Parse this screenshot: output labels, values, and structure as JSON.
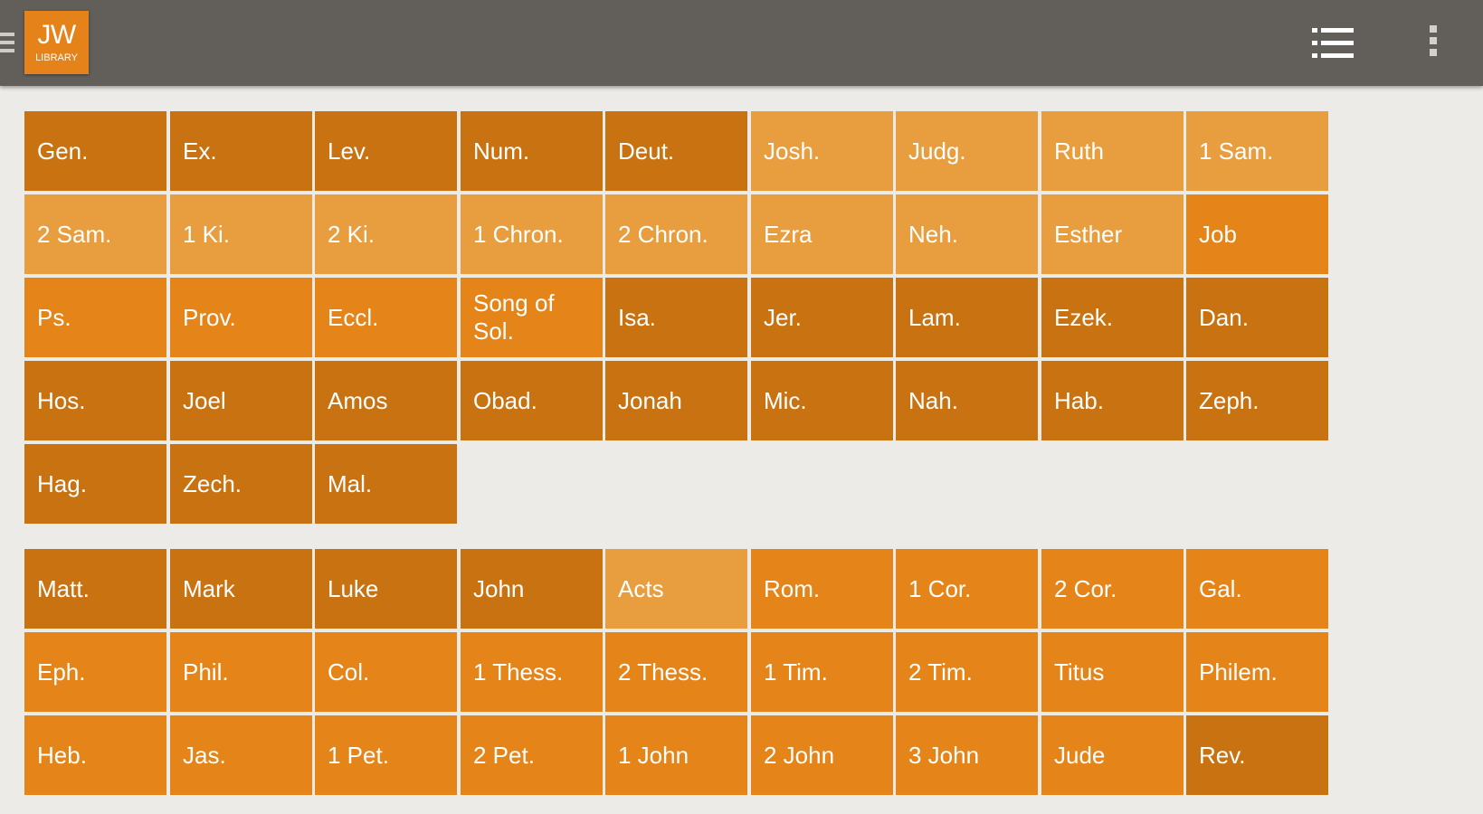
{
  "app": {
    "logo_top": "JW",
    "logo_bottom": "LIBRARY",
    "icons": [
      "drawer-menu-icon",
      "list-view-icon",
      "overflow-menu-icon"
    ]
  },
  "colors": {
    "appbar": "#625e5a",
    "background": "#edebe8",
    "tile_dark": "#c87212",
    "tile_light": "#e89d3e",
    "tile_mid": "#e58419"
  },
  "hebrew_books": [
    {
      "label": "Gen.",
      "color": "dark"
    },
    {
      "label": "Ex.",
      "color": "dark"
    },
    {
      "label": "Lev.",
      "color": "dark"
    },
    {
      "label": "Num.",
      "color": "dark"
    },
    {
      "label": "Deut.",
      "color": "dark"
    },
    {
      "label": "Josh.",
      "color": "light"
    },
    {
      "label": "Judg.",
      "color": "light"
    },
    {
      "label": "Ruth",
      "color": "light"
    },
    {
      "label": "1 Sam.",
      "color": "light"
    },
    {
      "label": "2 Sam.",
      "color": "light"
    },
    {
      "label": "1 Ki.",
      "color": "light"
    },
    {
      "label": "2 Ki.",
      "color": "light"
    },
    {
      "label": "1 Chron.",
      "color": "light"
    },
    {
      "label": "2 Chron.",
      "color": "light"
    },
    {
      "label": "Ezra",
      "color": "light"
    },
    {
      "label": "Neh.",
      "color": "light"
    },
    {
      "label": "Esther",
      "color": "light"
    },
    {
      "label": "Job",
      "color": "mid"
    },
    {
      "label": "Ps.",
      "color": "mid"
    },
    {
      "label": "Prov.",
      "color": "mid"
    },
    {
      "label": "Eccl.",
      "color": "mid"
    },
    {
      "label": "Song of Sol.",
      "color": "mid"
    },
    {
      "label": "Isa.",
      "color": "dark"
    },
    {
      "label": "Jer.",
      "color": "dark"
    },
    {
      "label": "Lam.",
      "color": "dark"
    },
    {
      "label": "Ezek.",
      "color": "dark"
    },
    {
      "label": "Dan.",
      "color": "dark"
    },
    {
      "label": "Hos.",
      "color": "dark"
    },
    {
      "label": "Joel",
      "color": "dark"
    },
    {
      "label": "Amos",
      "color": "dark"
    },
    {
      "label": "Obad.",
      "color": "dark"
    },
    {
      "label": "Jonah",
      "color": "dark"
    },
    {
      "label": "Mic.",
      "color": "dark"
    },
    {
      "label": "Nah.",
      "color": "dark"
    },
    {
      "label": "Hab.",
      "color": "dark"
    },
    {
      "label": "Zeph.",
      "color": "dark"
    },
    {
      "label": "Hag.",
      "color": "dark"
    },
    {
      "label": "Zech.",
      "color": "dark"
    },
    {
      "label": "Mal.",
      "color": "dark"
    }
  ],
  "greek_books": [
    {
      "label": "Matt.",
      "color": "dark"
    },
    {
      "label": "Mark",
      "color": "dark"
    },
    {
      "label": "Luke",
      "color": "dark"
    },
    {
      "label": "John",
      "color": "dark"
    },
    {
      "label": "Acts",
      "color": "light"
    },
    {
      "label": "Rom.",
      "color": "mid"
    },
    {
      "label": "1 Cor.",
      "color": "mid"
    },
    {
      "label": "2 Cor.",
      "color": "mid"
    },
    {
      "label": "Gal.",
      "color": "mid"
    },
    {
      "label": "Eph.",
      "color": "mid"
    },
    {
      "label": "Phil.",
      "color": "mid"
    },
    {
      "label": "Col.",
      "color": "mid"
    },
    {
      "label": "1 Thess.",
      "color": "mid"
    },
    {
      "label": "2 Thess.",
      "color": "mid"
    },
    {
      "label": "1 Tim.",
      "color": "mid"
    },
    {
      "label": "2 Tim.",
      "color": "mid"
    },
    {
      "label": "Titus",
      "color": "mid"
    },
    {
      "label": "Philem.",
      "color": "mid"
    },
    {
      "label": "Heb.",
      "color": "mid"
    },
    {
      "label": "Jas.",
      "color": "mid"
    },
    {
      "label": "1 Pet.",
      "color": "mid"
    },
    {
      "label": "2 Pet.",
      "color": "mid"
    },
    {
      "label": "1 John",
      "color": "mid"
    },
    {
      "label": "2 John",
      "color": "mid"
    },
    {
      "label": "3 John",
      "color": "mid"
    },
    {
      "label": "Jude",
      "color": "mid"
    },
    {
      "label": "Rev.",
      "color": "dark"
    }
  ]
}
